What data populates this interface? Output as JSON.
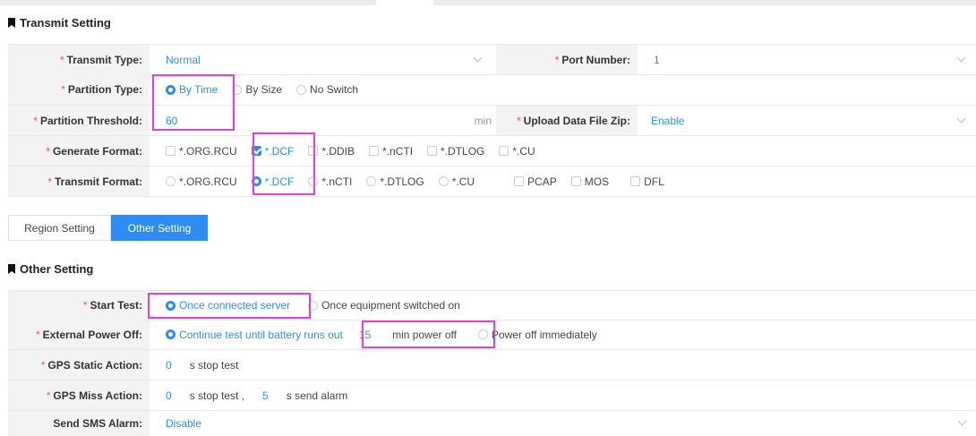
{
  "transmit_section": {
    "title": "Transmit Setting"
  },
  "transmit_type": {
    "label": "Transmit Type:",
    "value": "Normal"
  },
  "port_number": {
    "label": "Port Number:",
    "value": "1"
  },
  "partition_type": {
    "label": "Partition Type:",
    "options": [
      "By Time",
      "By Size",
      "No Switch"
    ],
    "selected": "By Time"
  },
  "partition_threshold": {
    "label": "Partition Threshold:",
    "value": "60",
    "unit": "min"
  },
  "upload_zip": {
    "label": "Upload Data File Zip:",
    "value": "Enable"
  },
  "generate_format": {
    "label": "Generate Format:",
    "options": [
      "*.ORG.RCU",
      "*.DCF",
      "*.DDIB",
      "*.nCTI",
      "*.DTLOG",
      "*.CU"
    ],
    "checked": [
      "*.DCF"
    ]
  },
  "transmit_format": {
    "label": "Transmit Format:",
    "radio_options": [
      "*.ORG.RCU",
      "*.DCF",
      "*.nCTI",
      "*.DTLOG",
      "*.CU"
    ],
    "selected": "*.DCF",
    "checkbox_options": [
      "PCAP",
      "MOS",
      "DFL"
    ]
  },
  "tabs": [
    {
      "label": "Region Setting",
      "active": false
    },
    {
      "label": "Other Setting",
      "active": true
    }
  ],
  "other_section": {
    "title": "Other Setting"
  },
  "start_test": {
    "label": "Start Test:",
    "options": [
      "Once connected server",
      "Once equipment switched on"
    ],
    "selected": "Once connected server"
  },
  "external_power_off": {
    "label": "External Power Off:",
    "option1": "Continue test until battery runs out",
    "minutes": "15",
    "minutes_suffix": "min power off",
    "option2": "Power off immediately"
  },
  "gps_static": {
    "label": "GPS Static Action:",
    "value": "0",
    "suffix": "s stop test"
  },
  "gps_miss": {
    "label": "GPS Miss Action:",
    "value1": "0",
    "suffix1": "s stop test ,",
    "value2": "5",
    "suffix2": "s send alarm"
  },
  "send_sms": {
    "label": "Send SMS Alarm:",
    "value": "Disable"
  },
  "colors": {
    "accent": "#2d8cf0",
    "required": "#ff4d4f",
    "highlight": "#e53fd9",
    "label_bg": "#f3f3f3"
  }
}
